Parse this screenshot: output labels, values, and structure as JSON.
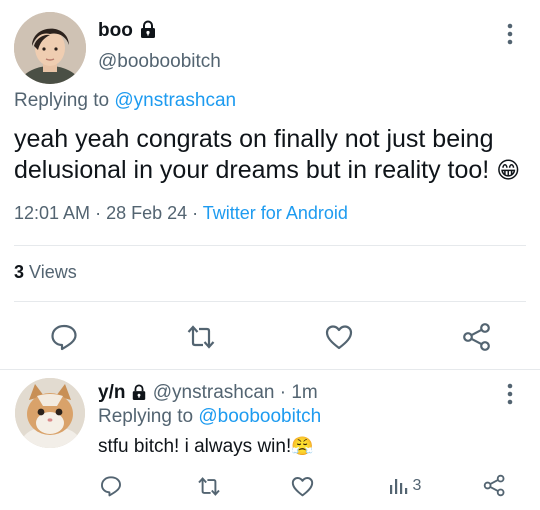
{
  "main_tweet": {
    "display_name": "boo",
    "handle": "@booboobitch",
    "replying_prefix": "Replying to",
    "replying_handle": "@ynstrashcan",
    "text_line1": "yeah yeah congrats on finally not just being",
    "text_line2": "delusional in your dreams but in reality too!",
    "emoji": "😁",
    "time": "12:01 AM",
    "date": "28 Feb 24",
    "client": "Twitter for Android",
    "views_count": "3",
    "views_label": "Views"
  },
  "reply_tweet": {
    "display_name": "y/n",
    "handle": "@ynstrashcan",
    "age": "1m",
    "replying_prefix": "Replying to",
    "replying_handle": "@booboobitch",
    "text": "stfu bitch! i always win!",
    "emoji": "😤",
    "views_count": "3"
  },
  "icons": [
    "more-icon",
    "lock-icon",
    "reply-icon",
    "retweet-icon",
    "like-icon",
    "share-icon",
    "views-icon"
  ],
  "colors": {
    "link": "#1d9bf0",
    "muted": "#536471",
    "text": "#0f1419",
    "divider": "#e6e9ec"
  }
}
